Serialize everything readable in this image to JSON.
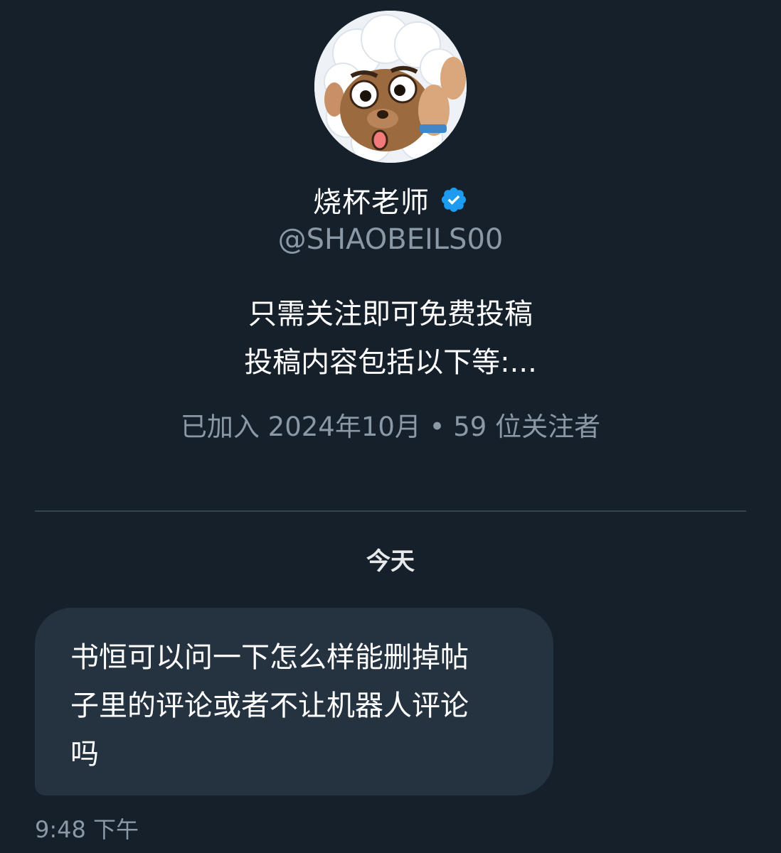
{
  "profile": {
    "avatar": "cartoon-sheep-avatar",
    "name": "烧杯老师",
    "verified_icon": "verified-badge-icon",
    "handle": "@SHAOBEILS00",
    "bio_lines": [
      "只需关注即可免费投稿",
      "投稿内容包括以下等:..."
    ],
    "joined": "已加入 2024年10月",
    "separator": "•",
    "followers": "59 位关注者"
  },
  "conversation": {
    "date_label": "今天",
    "messages": [
      {
        "lines": [
          "书恒可以问一下怎么样能删掉帖",
          "子里的评论或者不让机器人评论",
          "吗"
        ],
        "time": "9:48 下午"
      }
    ]
  },
  "colors": {
    "background": "#15202b",
    "bubble": "#253341",
    "secondary_text": "#8b98a5",
    "verified": "#1d9bf0",
    "divider": "#38444d"
  }
}
